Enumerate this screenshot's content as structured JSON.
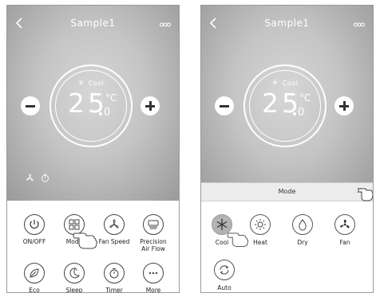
{
  "left": {
    "title": "Sample1",
    "mode": "Cool",
    "temp_main": "25",
    "temp_dec": "0",
    "unit": "C",
    "grid": [
      {
        "label": "ON/OFF",
        "icon": "power-icon"
      },
      {
        "label": "Mode",
        "icon": "mode-icon"
      },
      {
        "label": "Fan Speed",
        "icon": "fan-speed-icon"
      },
      {
        "label": "Precision\nAir Flow",
        "icon": "air-flow-icon"
      },
      {
        "label": "Eco",
        "icon": "eco-leaf-icon"
      },
      {
        "label": "Sleep",
        "icon": "sleep-moon-icon"
      },
      {
        "label": "Timer",
        "icon": "timer-icon"
      },
      {
        "label": "More",
        "icon": "more-dots-icon"
      }
    ]
  },
  "right": {
    "title": "Sample1",
    "mode": "Cool",
    "temp_main": "25",
    "temp_dec": "0",
    "unit": "C",
    "popup": {
      "title": "Mode",
      "close": "X",
      "modes": [
        {
          "label": "Cool",
          "icon": "snowflake-icon",
          "active": true
        },
        {
          "label": "Heat",
          "icon": "sun-icon",
          "active": false
        },
        {
          "label": "Dry",
          "icon": "water-drop-icon",
          "active": false
        },
        {
          "label": "Fan",
          "icon": "fan-icon",
          "active": false
        },
        {
          "label": "Auto",
          "icon": "auto-cycle-icon",
          "active": false
        }
      ]
    }
  }
}
